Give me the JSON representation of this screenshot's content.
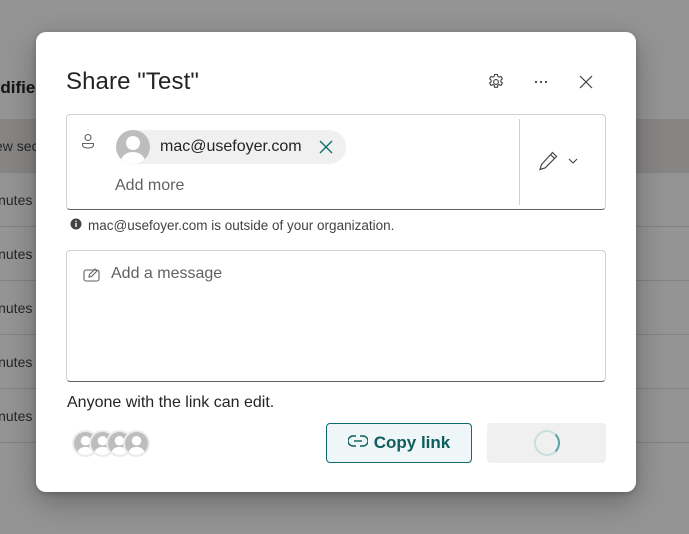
{
  "background": {
    "column_header": "odified",
    "rows": [
      {
        "text": "ew sec",
        "selected": true
      },
      {
        "text": "inutes"
      },
      {
        "text": "inutes"
      },
      {
        "text": "inutes"
      },
      {
        "text": "inutes"
      },
      {
        "text": "inutes"
      }
    ]
  },
  "dialog": {
    "title": "Share \"Test\"",
    "header_buttons": {
      "settings": "gear-icon",
      "more": "ellipsis-icon",
      "close": "close-icon"
    },
    "recipients": {
      "chips": [
        {
          "email": "mac@usefoyer.com",
          "remove_icon": "close-icon"
        }
      ],
      "add_more_placeholder": "Add more",
      "permission": {
        "icon": "pencil-icon",
        "level": "Can edit"
      }
    },
    "notice": {
      "icon": "info-icon",
      "text": "mac@usefoyer.com is outside of your organization."
    },
    "message": {
      "placeholder": "Add a message",
      "value": ""
    },
    "link_description": "Anyone with the link can edit.",
    "facepile_count": 4,
    "copy_link_label": "Copy link",
    "send_state": "loading",
    "colors": {
      "accent": "#0f6c6c",
      "copy_bg": "#eef6f7"
    }
  }
}
